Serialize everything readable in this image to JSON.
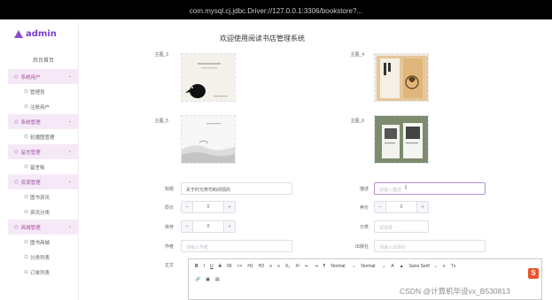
{
  "topbar": {
    "text": "com.mysql.cj.jdbc.Driver://127.0.0.1:3306/bookstore?..."
  },
  "sidebar": {
    "logo_text": "admin",
    "home": "后台首页",
    "groups": [
      {
        "label": "系统用户",
        "items": [
          "管理员",
          "注册用户"
        ]
      },
      {
        "label": "系统管理",
        "items": [
          "轮播图管理"
        ]
      },
      {
        "label": "留言管理",
        "items": [
          "留言板"
        ]
      },
      {
        "label": "资源管理",
        "items": [
          "图书资讯",
          "资讯分类"
        ]
      },
      {
        "label": "商城管理",
        "items": [
          "图书商城",
          "分类列表",
          "订单列表"
        ]
      }
    ]
  },
  "main": {
    "title": "欢迎使用阅读书店管理系统",
    "images": [
      {
        "label": "主图_3",
        "alt": "bird-book-cover"
      },
      {
        "label": "主图_4",
        "alt": "orange-book-cover"
      },
      {
        "label": "主图_5",
        "alt": "grey-landscape-cover"
      },
      {
        "label": "主图_6",
        "alt": "green-book-cover"
      }
    ],
    "fields": {
      "title_label": "标题",
      "title_value": "关于时光寿司和闲情的",
      "desc_label": "描述",
      "desc_placeholder": "请输入描述",
      "original_price_label": "原价",
      "original_price_value": "0",
      "sale_price_label": "卖价",
      "sale_price_value": "0",
      "stock_label": "库存",
      "stock_value": "0",
      "category_label": "分类",
      "category_placeholder": "请选择",
      "author_label": "作者",
      "author_placeholder": "请输入作者",
      "publisher_label": "出版社",
      "publisher_placeholder": "请输入出版社",
      "body_label": "正文"
    },
    "editor": {
      "bold": "B",
      "italic": "I",
      "underline": "U",
      "strike": "S",
      "quote": "99",
      "code": "<>",
      "h1": "H1",
      "h2": "H2",
      "ol": "≡",
      "ul": "≡",
      "sub": "X₂",
      "sup": "X²",
      "indent_left": "⇤",
      "indent_right": "⇥",
      "direction": "¶",
      "size1": "Normal",
      "size2": "Normal",
      "font_color": "A",
      "background": "▲",
      "font": "Sans Serif",
      "align": "≡",
      "clean": "Tx",
      "link": "🔗",
      "image": "▣",
      "video": "▤"
    }
  },
  "watermark": {
    "text": "CSDN @计算机毕设vx_B530813",
    "logo": "S"
  }
}
